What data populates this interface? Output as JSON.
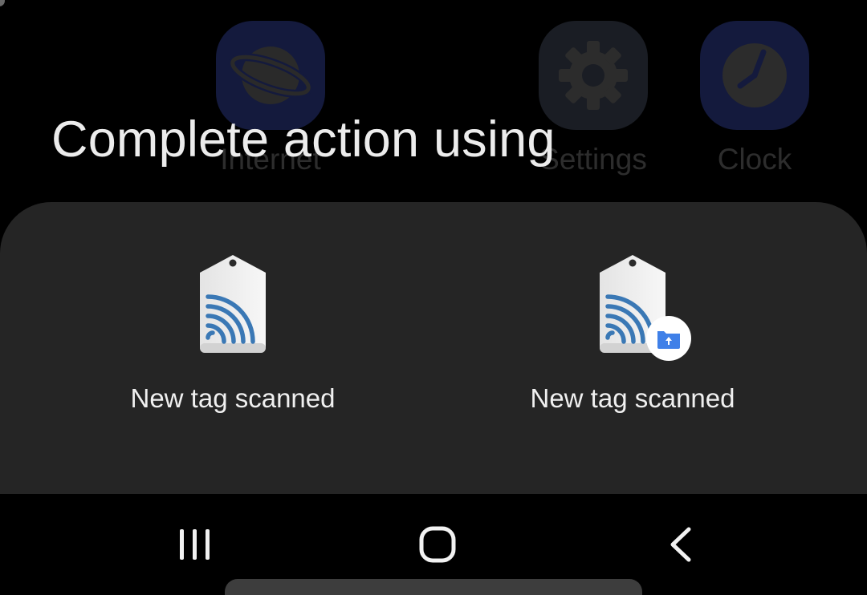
{
  "background_apps": [
    {
      "label": "Internet",
      "icon": "internet-planet-icon"
    },
    {
      "label": "Settings",
      "icon": "gear-icon"
    },
    {
      "label": "Clock",
      "icon": "clock-icon"
    }
  ],
  "chooser": {
    "title": "Complete action using",
    "options": [
      {
        "label": "New tag scanned",
        "icon": "nfc-tag-icon"
      },
      {
        "label": "New tag scanned",
        "icon": "nfc-tag-folder-icon"
      }
    ]
  },
  "nav_bar": {
    "recents": "recents-icon",
    "home": "home-icon",
    "back": "back-chevron-icon"
  },
  "colors": {
    "sheet": "#252525",
    "title_text": "#ececec",
    "folder_badge": "#3f80e8"
  }
}
